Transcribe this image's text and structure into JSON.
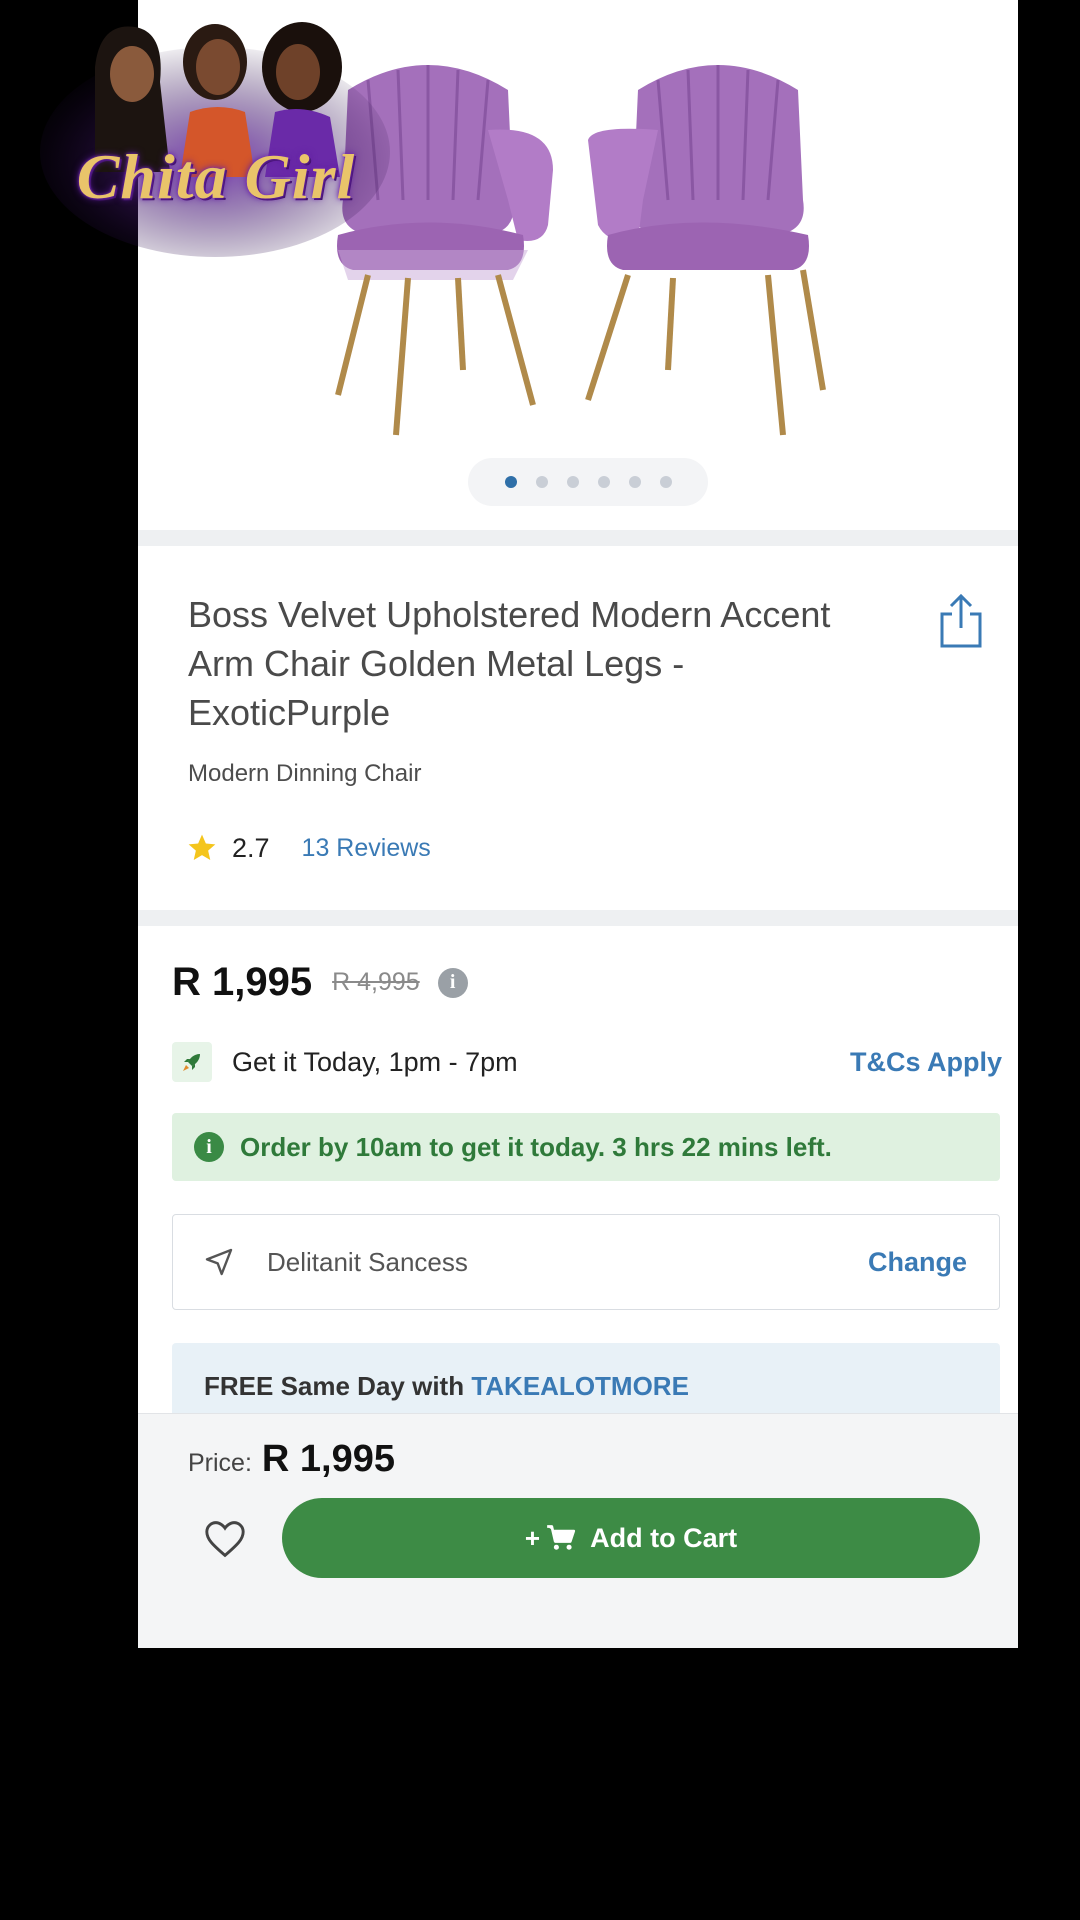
{
  "gallery": {
    "image_count": 6,
    "active_index": 0
  },
  "product": {
    "title": "Boss Velvet Upholstered Modern Accent Arm Chair Golden Metal Legs - ExoticPurple",
    "subtitle": "Modern Dinning Chair",
    "rating": "2.7",
    "reviews": "13 Reviews"
  },
  "pricing": {
    "price": "R 1,995",
    "old_price": "R 4,995"
  },
  "delivery": {
    "text": "Get it Today, 1pm - 7pm",
    "terms_link": "T&Cs Apply",
    "order_notice": "Order by 10am to get it today. 3 hrs 22 mins left.",
    "location": "Delitanit Sancess",
    "change_label": "Change",
    "free_prefix": "FREE Same Day with",
    "free_link": "TAKEALOTMORE"
  },
  "bottom_bar": {
    "price_label": "Price:",
    "price_value": "R 1,995",
    "add_to_cart_plus": "+",
    "add_to_cart_label": "Add to Cart"
  },
  "overlay": {
    "logo_text": "Chita Girl"
  },
  "colors": {
    "accent_blue": "#3a7ab5",
    "green": "#3d8b45",
    "green_banner": "#dff1e0",
    "chair_purple": "#a86fbf",
    "legs_gold": "#b08a4a"
  },
  "icons": {
    "share": "share-icon",
    "star": "star-icon",
    "info": "info-icon",
    "rocket": "rocket-icon",
    "navigation": "navigation-arrow-icon",
    "heart": "heart-icon",
    "cart": "cart-icon"
  }
}
